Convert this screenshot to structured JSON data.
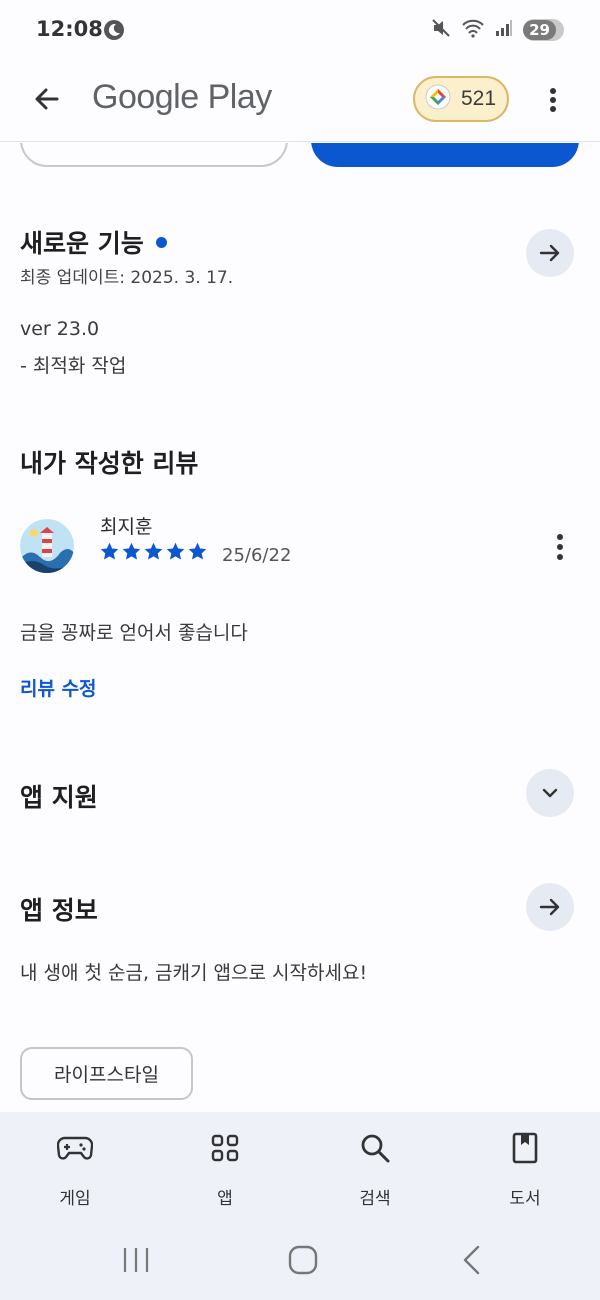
{
  "status_bar": {
    "time": "12:08",
    "battery": "29"
  },
  "app_bar": {
    "title": "Google Play",
    "points": "521"
  },
  "whats_new": {
    "title": "새로운 기능",
    "updated": "최종 업데이트: 2025. 3. 17.",
    "version": "ver 23.0",
    "notes": "- 최적화 작업"
  },
  "my_review": {
    "title": "내가 작성한 리뷰",
    "reviewer": "최지훈",
    "rating": 5,
    "date": "25/6/22",
    "text": "금을 꽁짜로 얻어서 좋습니다",
    "edit_label": "리뷰 수정"
  },
  "app_support": {
    "title": "앱 지원"
  },
  "app_info": {
    "title": "앱 정보",
    "description": "내 생애 첫 순금, 금캐기 앱으로 시작하세요!",
    "category": "라이프스타일"
  },
  "bottom_nav": [
    {
      "label": "게임",
      "icon": "gamepad-icon"
    },
    {
      "label": "앱",
      "icon": "apps-grid-icon"
    },
    {
      "label": "검색",
      "icon": "search-icon"
    },
    {
      "label": "도서",
      "icon": "book-icon"
    }
  ],
  "colors": {
    "accent": "#0b57d0",
    "nav_bg": "#eef2f8",
    "chip_bg": "#fcefcb"
  }
}
